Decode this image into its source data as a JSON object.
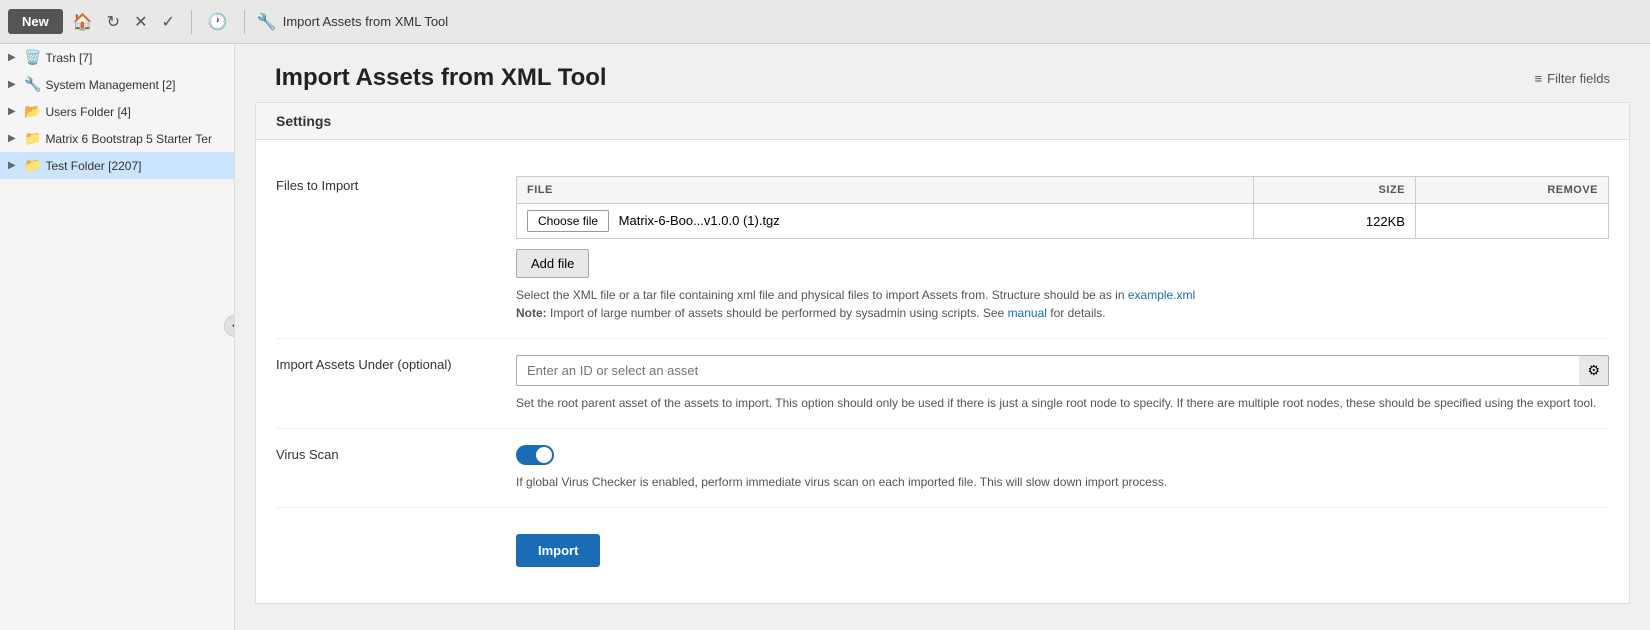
{
  "toolbar": {
    "new_label": "New",
    "tool_label": "Import Assets from XML Tool"
  },
  "sidebar": {
    "items": [
      {
        "id": "trash",
        "label": "Trash [7]",
        "icon": "🗑️",
        "selected": false
      },
      {
        "id": "system-management",
        "label": "System Management [2]",
        "icon": "🔧",
        "selected": false
      },
      {
        "id": "users-folder",
        "label": "Users Folder [4]",
        "icon": "📂",
        "selected": false
      },
      {
        "id": "matrix-bootstrap",
        "label": "Matrix 6 Bootstrap 5 Starter Ter",
        "icon": "📁",
        "selected": false
      },
      {
        "id": "test-folder",
        "label": "Test Folder [2207]",
        "icon": "📁",
        "selected": true
      }
    ],
    "collapse_label": "<"
  },
  "page": {
    "title": "Import Assets from XML Tool",
    "filter_label": "Filter fields"
  },
  "settings": {
    "header": "Settings",
    "files_to_import_label": "Files to Import",
    "file_table": {
      "col_file": "FILE",
      "col_size": "SIZE",
      "col_remove": "REMOVE",
      "rows": [
        {
          "choose_label": "Choose file",
          "filename": "Matrix-6-Boo...v1.0.0 (1).tgz",
          "size": "122KB"
        }
      ]
    },
    "add_file_label": "Add file",
    "help_text_1": "Select the XML file or a tar file containing xml file and physical files to import Assets from. Structure should be as in ",
    "example_link": "example.xml",
    "help_text_note": "Note:",
    "help_text_2": " Import of large number of assets should be performed by sysadmin using scripts. See ",
    "manual_link": "manual",
    "help_text_3": " for details.",
    "import_assets_label": "Import Assets Under (optional)",
    "asset_input_placeholder": "Enter an ID or select an asset",
    "asset_select_icon": "⚙",
    "asset_help_text": "Set the root parent asset of the assets to import. This option should only be used if there is just a single root node to specify. If there are multiple root nodes, these should be specified using the export tool.",
    "virus_scan_label": "Virus Scan",
    "virus_scan_help": "If global Virus Checker is enabled, perform immediate virus scan on each imported file. This will slow down import process.",
    "import_label": "Import"
  }
}
